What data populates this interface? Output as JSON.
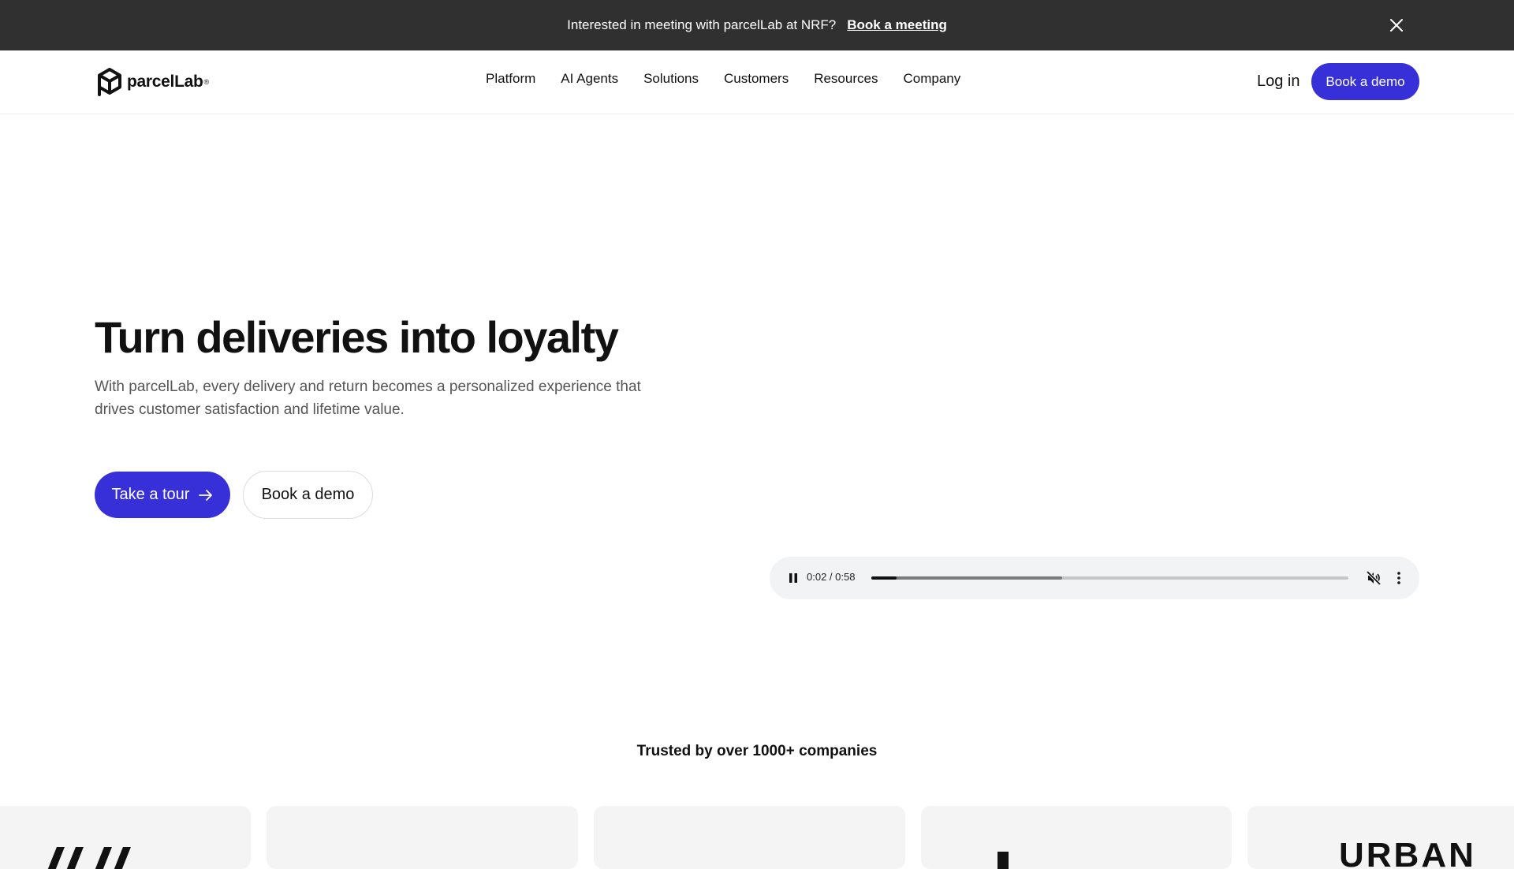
{
  "announcement": {
    "message": "Interested in meeting with parcelLab at NRF?",
    "cta": "Book a meeting",
    "close_icon": "close-icon"
  },
  "header": {
    "brand": "parcelLab",
    "nav": [
      {
        "label": "Platform"
      },
      {
        "label": "AI Agents"
      },
      {
        "label": "Solutions"
      },
      {
        "label": "Customers"
      },
      {
        "label": "Resources"
      },
      {
        "label": "Company"
      }
    ],
    "login": "Log in",
    "demo": "Book a demo"
  },
  "hero": {
    "title": "Turn deliveries into loyalty",
    "subtitle": "With parcelLab, every delivery and return becomes a personalized experience that drives customer satisfaction and lifetime value.",
    "tour_button": "Take a tour",
    "demo_button": "Book a demo"
  },
  "video": {
    "time": "0:02 / 0:58",
    "played_fraction": 0.053,
    "buffered_fraction": 0.4
  },
  "trusted": {
    "heading": "Trusted by over 1000+ companies",
    "logos": [
      "",
      "",
      "",
      "",
      "URBAN"
    ]
  },
  "colors": {
    "accent": "#3730d9",
    "announcement_bg": "#303030",
    "player_bg": "#f1f3f4"
  }
}
